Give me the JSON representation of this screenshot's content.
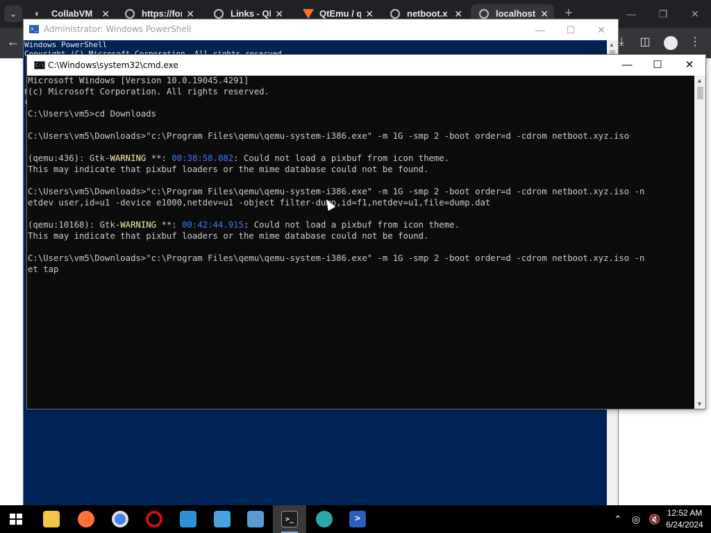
{
  "browser": {
    "tabs": [
      {
        "title": "CollabVM",
        "active": false,
        "icon": "collabvm-icon"
      },
      {
        "title": "https://for",
        "active": false,
        "icon": "globe-icon"
      },
      {
        "title": "Links - QE",
        "active": false,
        "icon": "globe-icon"
      },
      {
        "title": "QtEmu / q",
        "active": false,
        "icon": "gitlab-icon"
      },
      {
        "title": "netboot.x",
        "active": false,
        "icon": "globe-icon"
      },
      {
        "title": "localhost",
        "active": true,
        "icon": "globe-icon"
      }
    ]
  },
  "powershell": {
    "title": "Administrator: Windows PowerShell",
    "lines": [
      "Windows PowerShell",
      "Copyright (C) Microsoft Corporation. All rights reserved."
    ],
    "left_fragments": [
      "",
      "",
      "",
      "",
      "F",
      "r",
      "",
      "F",
      "",
      "",
      "I",
      "F",
      "",
      "",
      "",
      "I",
      "F",
      "",
      "F"
    ]
  },
  "cmd": {
    "title": "C:\\Windows\\system32\\cmd.exe",
    "lines": {
      "l1": "Microsoft Windows [Version 10.0.19045.4291]",
      "l2": "(c) Microsoft Corporation. All rights reserved.",
      "l4": "C:\\Users\\vm5>cd Downloads",
      "l6": "C:\\Users\\vm5\\Downloads>\"c:\\Program Files\\qemu\\qemu-system-i386.exe\" -m 1G -smp 2 -boot order=d -cdrom netboot.xyz.iso",
      "l8_pre": "(qemu:436): Gtk-",
      "l8_warn": "WARNING",
      "l8_mid": " **: ",
      "l8_ts": "00:38:58.082",
      "l8_post": ": Could not load a pixbuf from icon theme.",
      "l9": "This may indicate that pixbuf loaders or the mime database could not be found.",
      "l11": "C:\\Users\\vm5\\Downloads>\"c:\\Program Files\\qemu\\qemu-system-i386.exe\" -m 1G -smp 2 -boot order=d -cdrom netboot.xyz.iso -n",
      "l12": "etdev user,id=u1 -device e1000,netdev=u1 -object filter-dump,id=f1,netdev=u1,file=dump.dat",
      "l14_pre": "(qemu:10168): Gtk-",
      "l14_warn": "WARNING",
      "l14_mid": " **: ",
      "l14_ts": "00:42:44.915",
      "l14_post": ": Could not load a pixbuf from icon theme.",
      "l15": "This may indicate that pixbuf loaders or the mime database could not be found.",
      "l17": "C:\\Users\\vm5\\Downloads>\"c:\\Program Files\\qemu\\qemu-system-i386.exe\" -m 1G -smp 2 -boot order=d -cdrom netboot.xyz.iso -n",
      "l18": "et tap"
    }
  },
  "taskbar": {
    "apps": [
      {
        "name": "file-explorer",
        "label": "",
        "color": "#f2c744",
        "active": false
      },
      {
        "name": "firefox",
        "label": "",
        "color": "#ff7139",
        "active": false
      },
      {
        "name": "chrome",
        "label": "",
        "color": "#4285f4",
        "active": false
      },
      {
        "name": "opera",
        "label": "O",
        "color": "#cc0f16",
        "active": false
      },
      {
        "name": "app-5",
        "label": "",
        "color": "#2f8fd6",
        "active": false
      },
      {
        "name": "app-6",
        "label": "",
        "color": "#4aa3df",
        "active": false
      },
      {
        "name": "app-7",
        "label": "",
        "color": "#5b9bd5",
        "active": false
      },
      {
        "name": "cmd",
        "label": ">_",
        "color": "#1e1e1e",
        "active": true
      },
      {
        "name": "edge",
        "label": "",
        "color": "#2fa6a6",
        "active": false
      },
      {
        "name": "powershell",
        "label": ">",
        "color": "#2a5fbf",
        "active": false
      }
    ],
    "time": "12:52 AM",
    "date": "6/24/2024"
  }
}
